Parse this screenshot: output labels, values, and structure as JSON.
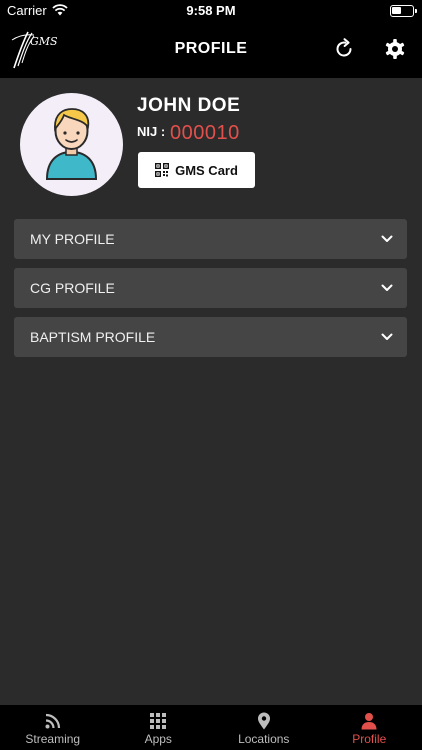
{
  "status_bar": {
    "carrier": "Carrier",
    "time": "9:58 PM"
  },
  "header": {
    "logo_text": "GMS",
    "title": "PROFILE",
    "refresh_icon": "refresh-icon",
    "settings_icon": "gear-icon"
  },
  "profile": {
    "name": "JOHN DOE",
    "nij_label": "NIJ :",
    "nij_value": "000010",
    "card_button_label": "GMS Card",
    "card_button_icon": "qr-code-icon"
  },
  "sections": [
    {
      "label": "MY PROFILE",
      "expanded": false
    },
    {
      "label": "CG PROFILE",
      "expanded": false
    },
    {
      "label": "BAPTISM PROFILE",
      "expanded": false
    }
  ],
  "tabs": [
    {
      "label": "Streaming",
      "icon": "rss-icon",
      "active": false
    },
    {
      "label": "Apps",
      "icon": "grid-icon",
      "active": false
    },
    {
      "label": "Locations",
      "icon": "map-pin-icon",
      "active": false
    },
    {
      "label": "Profile",
      "icon": "person-icon",
      "active": true
    }
  ],
  "colors": {
    "accent": "#e2504c",
    "background": "#2b2b2b",
    "bar": "#000000",
    "section": "#454545"
  }
}
